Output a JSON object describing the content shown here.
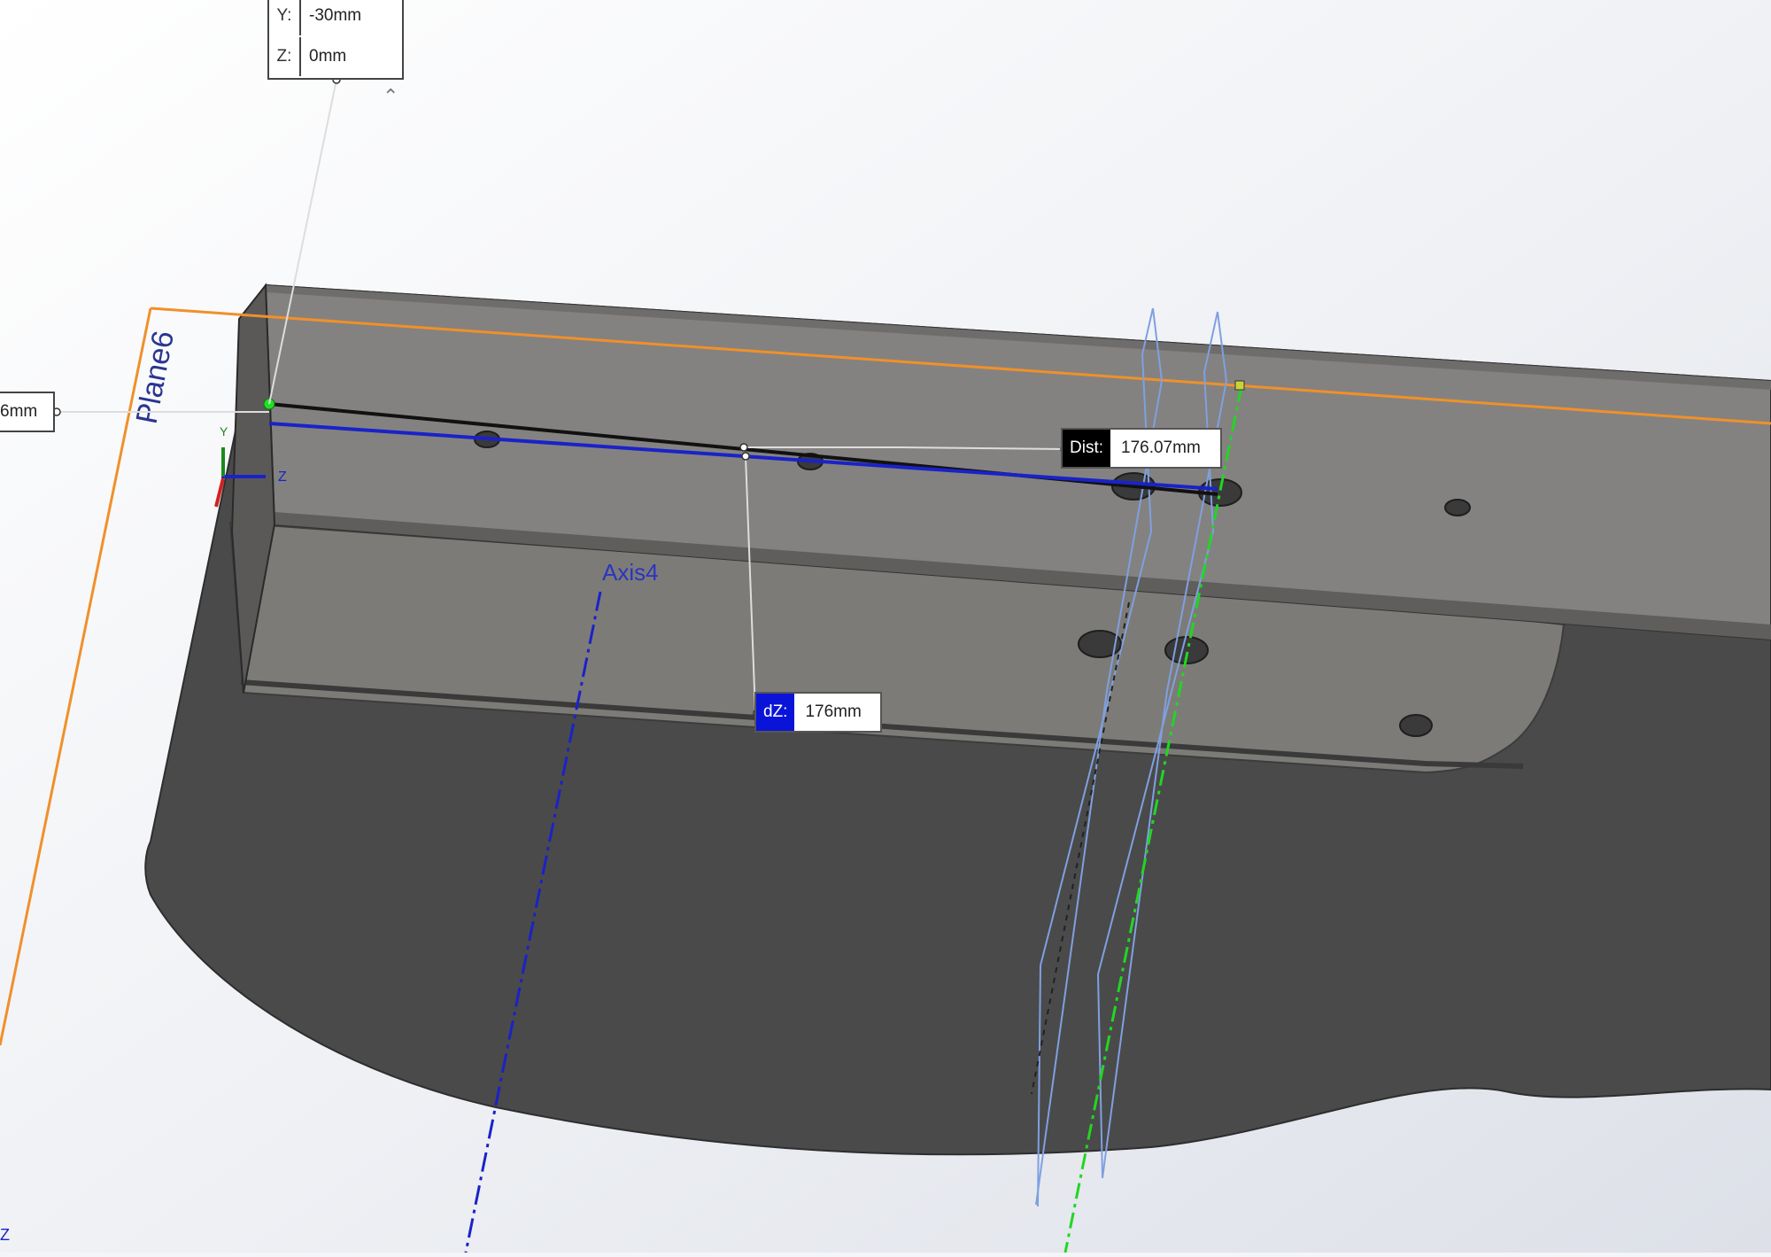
{
  "coord_callout": {
    "y_key": "Y:",
    "y_value": "-30mm",
    "z_key": "Z:",
    "z_value": "0mm"
  },
  "left_callout": {
    "value": "6mm"
  },
  "dist_callout": {
    "label": "Dist:",
    "value": "176.07mm"
  },
  "dz_callout": {
    "label": "dZ:",
    "value": "176mm"
  },
  "plane_label": "Plane6",
  "axis_label": "Axis4",
  "triad": {
    "y": "Y",
    "z": "Z"
  },
  "corner_axis": "Z",
  "colors": {
    "plane": "#f0902a",
    "axis": "#1a22c8",
    "measure_line": "#1a22c8",
    "green_axis": "#22d622",
    "dz_label_bg": "#0a14d8",
    "dist_label_bg": "#000000"
  }
}
